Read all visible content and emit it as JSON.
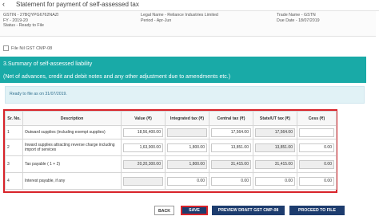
{
  "header": {
    "title": "Statement for payment of self-assessed tax"
  },
  "info": {
    "gstin": "GSTIN - 27BQYPG6762NAZI",
    "fy": "FY - 2019-20",
    "status": "Status - Ready to File",
    "legal_name": "Legal Name - Reliance Industries Limited",
    "period": "Period - Apr-Jun",
    "trade_name": "Trade Name - GSTN",
    "due_date": "Due Date - 18/07/2019"
  },
  "file_nil": {
    "label": "File Nil GST CMP-08"
  },
  "section": {
    "title": "3.Summary of self-assessed liability",
    "subtitle": "(Net of advances, credit and debit notes and any other adjustment due to amendments etc.)"
  },
  "notice": "Ready to file as on 31/07/2019.",
  "table": {
    "headers": [
      "Sr. No.",
      "Description",
      "Value (₹)",
      "Integrated tax (₹)",
      "Central tax (₹)",
      "State/UT tax (₹)",
      "Cess (₹)"
    ],
    "rows": [
      {
        "sr": "1",
        "desc": "Outward supplies (including exempt supplies)",
        "value": "18,56,400.00",
        "igst": "",
        "cgst": "17,564.00",
        "sgst": "17,564.00",
        "cess": ""
      },
      {
        "sr": "2",
        "desc": "Inward supplies attracting reverse charge including import of services",
        "value": "1,63,900.00",
        "igst": "1,800.00",
        "cgst": "13,851.00",
        "sgst": "13,851.00",
        "cess": "0.00"
      },
      {
        "sr": "3",
        "desc": "Tax payable ( 1 + 2)",
        "value": "20,20,300.00",
        "igst": "1,800.00",
        "cgst": "31,415.00",
        "sgst": "31,415.00",
        "cess": "0.00"
      },
      {
        "sr": "4",
        "desc": "Interest payable, if any",
        "value": "",
        "igst": "0.00",
        "cgst": "0.00",
        "sgst": "0.00",
        "cess": "0.00"
      }
    ]
  },
  "buttons": {
    "back": "BACK",
    "save": "SAVE",
    "preview": "PREVIEW DRAFT GST CMP-08",
    "proceed": "PROCEED TO FILE"
  }
}
